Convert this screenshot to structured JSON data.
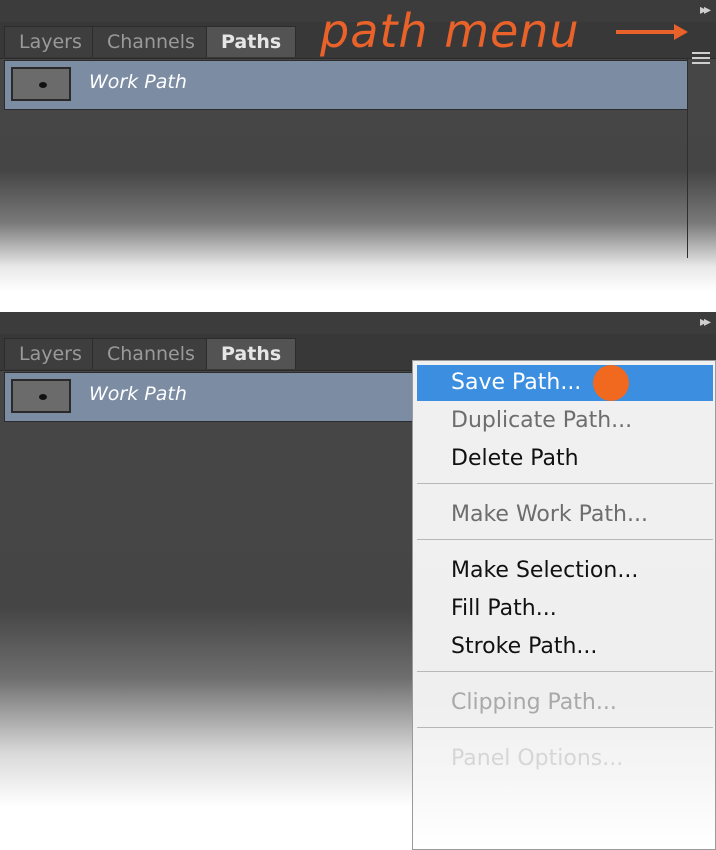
{
  "panel_top": {
    "tabs": [
      "Layers",
      "Channels",
      "Paths"
    ],
    "active_tab": "Paths",
    "row_label": "Work Path",
    "annotation": "path menu",
    "accent_color": "#e8622a"
  },
  "panel_bottom": {
    "tabs": [
      "Layers",
      "Channels",
      "Paths"
    ],
    "active_tab": "Paths",
    "row_label": "Work Path",
    "menu": {
      "items": [
        {
          "label": "Save Path...",
          "state": "highlighted"
        },
        {
          "label": "Duplicate Path...",
          "state": "normal"
        },
        {
          "label": "Delete Path",
          "state": "normal"
        },
        {
          "label": "Make Work Path...",
          "state": "disabled"
        },
        {
          "label": "Make Selection...",
          "state": "normal"
        },
        {
          "label": "Fill Path...",
          "state": "normal"
        },
        {
          "label": "Stroke Path...",
          "state": "normal"
        },
        {
          "label": "Clipping Path...",
          "state": "disabled"
        },
        {
          "label": "Panel Options...",
          "state": "disabled"
        }
      ],
      "highlight_color": "#3c8fe0",
      "cursor_color": "#f1681f"
    }
  }
}
